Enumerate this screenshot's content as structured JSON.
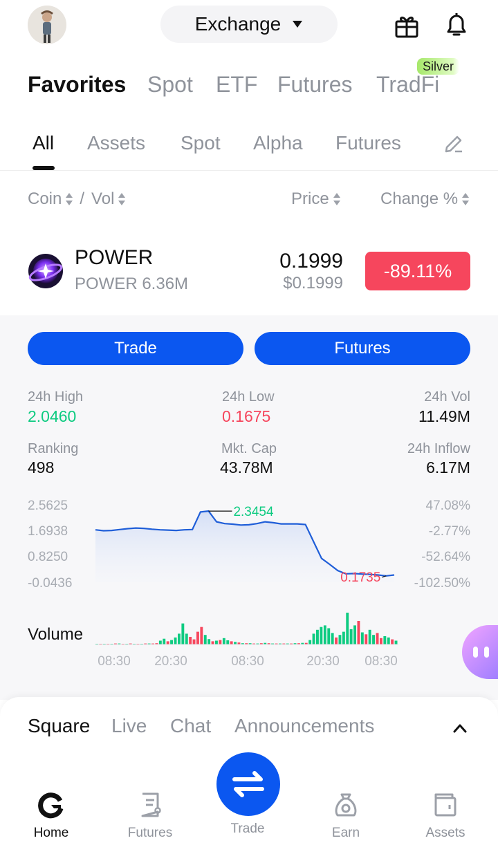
{
  "header": {
    "exchange_label": "Exchange"
  },
  "top_tabs": [
    {
      "label": "Favorites",
      "active": true
    },
    {
      "label": "Spot",
      "active": false
    },
    {
      "label": "ETF",
      "active": false
    },
    {
      "label": "Futures",
      "active": false
    },
    {
      "label": "TradFi",
      "active": false
    }
  ],
  "silver_badge": "Silver",
  "sub_tabs": [
    {
      "label": "All",
      "active": true
    },
    {
      "label": "Assets",
      "active": false
    },
    {
      "label": "Spot",
      "active": false
    },
    {
      "label": "Alpha",
      "active": false
    },
    {
      "label": "Futures",
      "active": false
    }
  ],
  "columns": {
    "coin": "Coin",
    "separator": "/",
    "vol": "Vol",
    "price": "Price",
    "change": "Change %"
  },
  "coin_row": {
    "symbol": "POWER",
    "pair_vol": "POWER 6.36M",
    "price": "0.1999",
    "price_usd": "$0.1999",
    "change": "-89.11%"
  },
  "actions": {
    "trade": "Trade",
    "futures": "Futures"
  },
  "stats": {
    "high_label": "24h High",
    "high_value": "2.0460",
    "low_label": "24h Low",
    "low_value": "0.1675",
    "vol_label": "24h Vol",
    "vol_value": "11.49M",
    "ranking_label": "Ranking",
    "ranking_value": "498",
    "mktcap_label": "Mkt. Cap",
    "mktcap_value": "43.78M",
    "inflow_label": "24h Inflow",
    "inflow_value": "6.17M"
  },
  "chart_data": {
    "type": "line",
    "y_ticks": [
      "2.5625",
      "1.6938",
      "0.8250",
      "-0.0436"
    ],
    "y_right_ticks": [
      "47.08%",
      "-2.77%",
      "-52.64%",
      "-102.50%"
    ],
    "ylim": [
      -0.0436,
      2.5625
    ],
    "x_ticks": [
      "08:30",
      "20:30",
      "08:30",
      "20:30",
      "08:30"
    ],
    "high_marker": "2.3454",
    "low_marker": "0.1735",
    "series": [
      {
        "values": [
          1.72,
          1.69,
          1.7,
          1.73,
          1.76,
          1.78,
          1.77,
          1.74,
          1.72,
          1.71,
          1.7,
          1.72,
          1.73,
          2.32,
          2.35,
          1.99,
          1.93,
          1.91,
          1.88,
          1.89,
          1.93,
          1.99,
          1.96,
          1.92,
          1.92,
          1.92,
          1.9,
          1.33,
          0.76,
          0.56,
          0.35,
          0.24,
          0.25,
          0.23,
          0.22,
          0.2,
          0.17,
          0.2
        ]
      }
    ],
    "volume": {
      "label": "Volume",
      "values": [
        0.02,
        0.02,
        0.02,
        0.02,
        0.02,
        0.03,
        0.03,
        0.02,
        0.02,
        0.03,
        0.02,
        0.02,
        0.02,
        0.03,
        0.03,
        0.03,
        0.04,
        0.12,
        0.18,
        0.1,
        0.14,
        0.22,
        0.34,
        0.66,
        0.34,
        0.24,
        0.16,
        0.4,
        0.55,
        0.3,
        0.17,
        0.1,
        0.12,
        0.14,
        0.2,
        0.13,
        0.1,
        0.08,
        0.06,
        0.04,
        0.04,
        0.04,
        0.03,
        0.03,
        0.04,
        0.05,
        0.04,
        0.03,
        0.03,
        0.03,
        0.03,
        0.03,
        0.03,
        0.04,
        0.04,
        0.05,
        0.05,
        0.14,
        0.34,
        0.46,
        0.55,
        0.6,
        0.51,
        0.36,
        0.22,
        0.3,
        0.4,
        1.0,
        0.48,
        0.6,
        0.74,
        0.38,
        0.32,
        0.46,
        0.3,
        0.36,
        0.2,
        0.26,
        0.22,
        0.16,
        0.12
      ],
      "colors": [
        "g",
        "r",
        "g",
        "r",
        "g",
        "r",
        "g",
        "r",
        "g",
        "r",
        "g",
        "r",
        "g",
        "r",
        "g",
        "r",
        "r",
        "g",
        "g",
        "r",
        "g",
        "g",
        "g",
        "g",
        "g",
        "r",
        "r",
        "r",
        "r",
        "g",
        "g",
        "r",
        "g",
        "r",
        "g",
        "g",
        "r",
        "g",
        "r",
        "g",
        "r",
        "g",
        "r",
        "g",
        "r",
        "g",
        "r",
        "g",
        "r",
        "g",
        "r",
        "g",
        "r",
        "g",
        "r",
        "g",
        "r",
        "g",
        "g",
        "g",
        "g",
        "g",
        "g",
        "g",
        "r",
        "g",
        "g",
        "g",
        "g",
        "g",
        "r",
        "g",
        "r",
        "g",
        "g",
        "r",
        "r",
        "g",
        "g",
        "r",
        "g"
      ]
    }
  },
  "sheet_tabs": [
    {
      "label": "Square",
      "active": true
    },
    {
      "label": "Live",
      "active": false
    },
    {
      "label": "Chat",
      "active": false
    },
    {
      "label": "Announcements",
      "active": false
    }
  ],
  "bottom_nav": {
    "home": "Home",
    "futures": "Futures",
    "trade": "Trade",
    "earn": "Earn",
    "assets": "Assets"
  },
  "colors": {
    "accent": "#0b57f0",
    "up": "#0ecb81",
    "down": "#f6465d",
    "badge": "#a6e86a"
  }
}
